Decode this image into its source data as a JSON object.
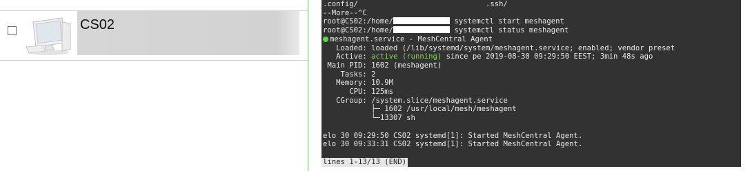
{
  "device": {
    "name": "CS02",
    "icon": "computer-icon"
  },
  "terminal": {
    "line0": ".config/                             .ssh/",
    "line1": "--More--^C",
    "line2_prefix": "root@CS02:/home/",
    "line2_suffix": " systemctl start meshagent",
    "line3_prefix": "root@CS02:/home/",
    "line3_suffix": " systemctl status meshagent",
    "line4": "meshagent.service - MeshCentral Agent",
    "line5": "   Loaded: loaded (/lib/systemd/system/meshagent.service; enabled; vendor preset",
    "line6_prefix": "   Active: ",
    "line6_active": "active (running)",
    "line6_suffix": " since pe 2019-08-30 09:29:50 EEST; 3min 48s ago",
    "line7": " Main PID: 1602 (meshagent)",
    "line8": "    Tasks: 2",
    "line9": "   Memory: 10.9M",
    "line10": "      CPU: 125ms",
    "line11": "   CGroup: /system.slice/meshagent.service",
    "line12": "           ├─ 1602 /usr/local/mesh/meshagent",
    "line13": "           └─13307 sh",
    "line14": "",
    "line15": "elo 30 09:29:50 CS02 systemd[1]: Started MeshCentral Agent.",
    "line16": "elo 30 09:33:31 CS02 systemd[1]: Started MeshCentral Agent.",
    "status_line": "lines 1-13/13 (END)"
  },
  "colors": {
    "terminal_bg": "#323232",
    "active_green": "#7bdc3f",
    "separator_green": "#7ec17e"
  }
}
